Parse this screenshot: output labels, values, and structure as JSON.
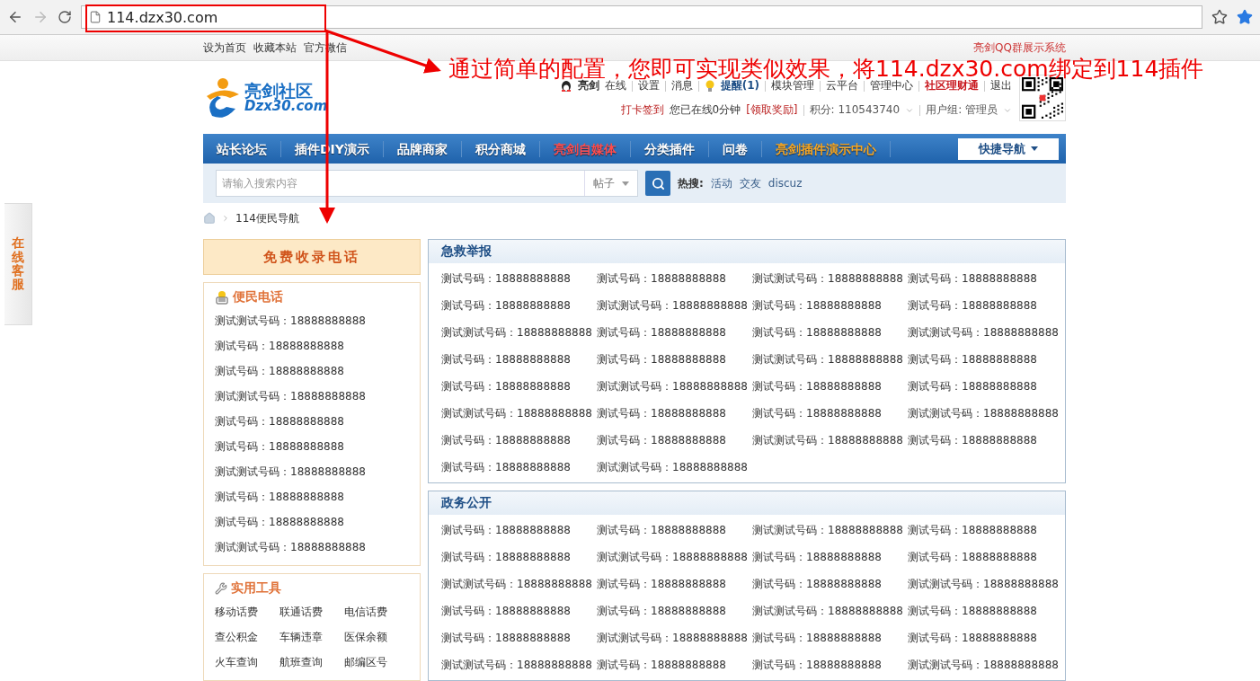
{
  "browser": {
    "url": "114.dzx30.com"
  },
  "topbar": {
    "links": [
      "设为首页",
      "收藏本站",
      "官方微信"
    ],
    "right_link": "亮剑QQ群展示系统"
  },
  "logo": {
    "title": "亮剑社区",
    "domain": "Dzx30.com"
  },
  "userbar": {
    "username": "亮剑",
    "status": "在线",
    "links": [
      {
        "label": "设置",
        "kind": "plain"
      },
      {
        "label": "消息",
        "kind": "plain"
      },
      {
        "label": "提醒(1)",
        "kind": "alert"
      },
      {
        "label": "模块管理",
        "kind": "plain"
      },
      {
        "label": "云平台",
        "kind": "plain"
      },
      {
        "label": "管理中心",
        "kind": "plain"
      },
      {
        "label": "社区理财通",
        "kind": "highlight"
      },
      {
        "label": "退出",
        "kind": "plain"
      }
    ],
    "checkin": "打卡签到",
    "online_time": "您已在线0分钟",
    "reward": "[领取奖励]",
    "points": "积分: 110543740",
    "group": "用户组: 管理员"
  },
  "nav": {
    "items": [
      {
        "label": "站长论坛",
        "color": "#ffffff"
      },
      {
        "label": "插件DIY演示",
        "color": "#ffffff"
      },
      {
        "label": "品牌商家",
        "color": "#ffffff"
      },
      {
        "label": "积分商城",
        "color": "#ffffff"
      },
      {
        "label": "亮剑自媒体",
        "color": "#ff4d4d"
      },
      {
        "label": "分类插件",
        "color": "#ffffff"
      },
      {
        "label": "问卷",
        "color": "#ffffff"
      },
      {
        "label": "亮剑插件演示中心",
        "color": "#f6a623"
      }
    ],
    "quick_nav": "快捷导航"
  },
  "search": {
    "placeholder": "请输入搜索内容",
    "scope": "帖子",
    "hot_label": "热搜:",
    "hot": [
      "活动",
      "交友",
      "discuz"
    ]
  },
  "breadcrumb": "114便民导航",
  "side_tab": "在线客服",
  "left": {
    "banner": "免费收录电话",
    "phones": {
      "title": "便民电话",
      "items": [
        "测试测试号码：18888888888",
        "测试号码：18888888888",
        "测试号码：18888888888",
        "测试测试号码：18888888888",
        "测试号码：18888888888",
        "测试号码：18888888888",
        "测试测试号码：18888888888",
        "测试号码：18888888888",
        "测试号码：18888888888",
        "测试测试号码：18888888888"
      ]
    },
    "tools": {
      "title": "实用工具",
      "items": [
        "移动话费",
        "联通话费",
        "电信话费",
        "查公积金",
        "车辆违章",
        "医保余额",
        "火车查询",
        "航班查询",
        "邮编区号"
      ]
    }
  },
  "sections": [
    {
      "title": "急救举报",
      "items": [
        "测试号码：18888888888",
        "测试号码：18888888888",
        "测试测试号码：18888888888",
        "测试号码：18888888888",
        "测试号码：18888888888",
        "测试测试号码：18888888888",
        "测试号码：18888888888",
        "测试号码：18888888888",
        "测试测试号码：18888888888",
        "测试号码：18888888888",
        "测试号码：18888888888",
        "测试测试号码：18888888888",
        "测试号码：18888888888",
        "测试号码：18888888888",
        "测试测试号码：18888888888",
        "测试号码：18888888888",
        "测试号码：18888888888",
        "测试测试号码：18888888888",
        "测试号码：18888888888",
        "测试号码：18888888888",
        "测试测试号码：18888888888",
        "测试号码：18888888888",
        "测试号码：18888888888",
        "测试测试号码：18888888888",
        "测试号码：18888888888",
        "测试号码：18888888888",
        "测试测试号码：18888888888",
        "测试号码：18888888888",
        "测试号码：18888888888",
        "测试测试号码：18888888888"
      ]
    },
    {
      "title": "政务公开",
      "items": [
        "测试号码：18888888888",
        "测试号码：18888888888",
        "测试测试号码：18888888888",
        "测试号码：18888888888",
        "测试号码：18888888888",
        "测试测试号码：18888888888",
        "测试号码：18888888888",
        "测试号码：18888888888",
        "测试测试号码：18888888888",
        "测试号码：18888888888",
        "测试号码：18888888888",
        "测试测试号码：18888888888",
        "测试号码：18888888888",
        "测试号码：18888888888",
        "测试测试号码：18888888888",
        "测试号码：18888888888",
        "测试号码：18888888888",
        "测试测试号码：18888888888",
        "测试号码：18888888888",
        "测试号码：18888888888",
        "测试测试号码：18888888888",
        "测试号码：18888888888",
        "测试号码：18888888888",
        "测试测试号码：18888888888"
      ]
    }
  ],
  "annotation": {
    "text": "通过简单的配置，您即可实现类似效果，将114.dzx30.com绑定到114插件"
  }
}
